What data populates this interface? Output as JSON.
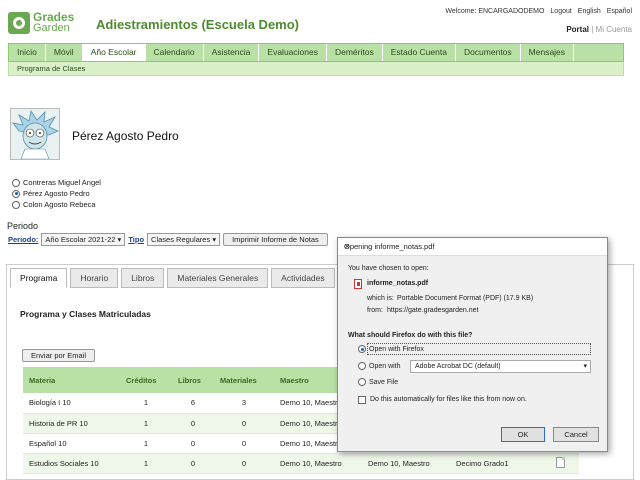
{
  "header": {
    "logo_line1": "Grades",
    "logo_line2": "Garden",
    "school": "Adiestramientos (Escuela Demo)",
    "welcome": "Welcome: ENCARGADODEMO",
    "logout": "Logout",
    "english": "English",
    "espanol": "Español",
    "portal": "Portal",
    "separator": "|",
    "mi_cuenta": "Mi Cuenta"
  },
  "nav": {
    "items": [
      "Inicio",
      "Móvil",
      "Año Escolar",
      "Calendario",
      "Asistencia",
      "Evaluaciones",
      "Deméritos",
      "Estado Cuenta",
      "Documentos",
      "Mensajes"
    ],
    "active_index": 2,
    "subnav": "Programa de Clases"
  },
  "student": {
    "name": "Pérez Agosto Pedro",
    "options": [
      {
        "label": "Contreras Miguel Angel",
        "selected": false
      },
      {
        "label": "Pérez Agosto Pedro",
        "selected": true
      },
      {
        "label": "Colon Agosto Rebeca",
        "selected": false
      }
    ]
  },
  "periodo": {
    "heading": "Periodo",
    "label": "Periodo:",
    "value": "Año Escolar 2021-22",
    "tipo_label": "Tipo",
    "tipo_value": "Clases Regulares",
    "print_button": "Imprimir Informe de Notas"
  },
  "tabs": [
    "Programa",
    "Horario",
    "Libros",
    "Materiales Generales",
    "Actividades"
  ],
  "program": {
    "title": "Programa y Clases Matriculadas",
    "email_button": "Enviar por Email",
    "columns": [
      "Materia",
      "Créditos",
      "Libros",
      "Materiales",
      "Maestro"
    ],
    "rows": [
      {
        "materia": "Biología I 10",
        "creditos": "1",
        "libros": "6",
        "materiales": "3",
        "maestro": "Demo 10, Maestro"
      },
      {
        "materia": "Historia de PR 10",
        "creditos": "1",
        "libros": "0",
        "materiales": "0",
        "maestro": "Demo 10, Maestro"
      },
      {
        "materia": "Español 10",
        "creditos": "1",
        "libros": "0",
        "materiales": "0",
        "maestro": "Demo 10, Maestro"
      },
      {
        "materia": "Estudios Sociales 10",
        "creditos": "1",
        "libros": "0",
        "materiales": "0",
        "maestro": "Demo 10, Maestro",
        "maestro2": "Demo 10, Maestro",
        "grado": "Decimo Grado1"
      }
    ]
  },
  "dialog": {
    "title": "Opening informe_notas.pdf",
    "intro": "You have chosen to open:",
    "filename": "informe_notas.pdf",
    "which_is": "which is:",
    "which_value": "Portable Document Format (PDF) (17.9 KB)",
    "from_label": "from:",
    "from_value": "https://gate.gradesgarden.net",
    "question": "What should Firefox do with this file?",
    "open_with_firefox": "Open with Firefox",
    "open_with": "Open with",
    "open_with_value": "Adobe Acrobat DC (default)",
    "save_file": "Save File",
    "auto_label": "Do this automatically for files like this from now on.",
    "ok": "OK",
    "cancel": "Cancel"
  }
}
